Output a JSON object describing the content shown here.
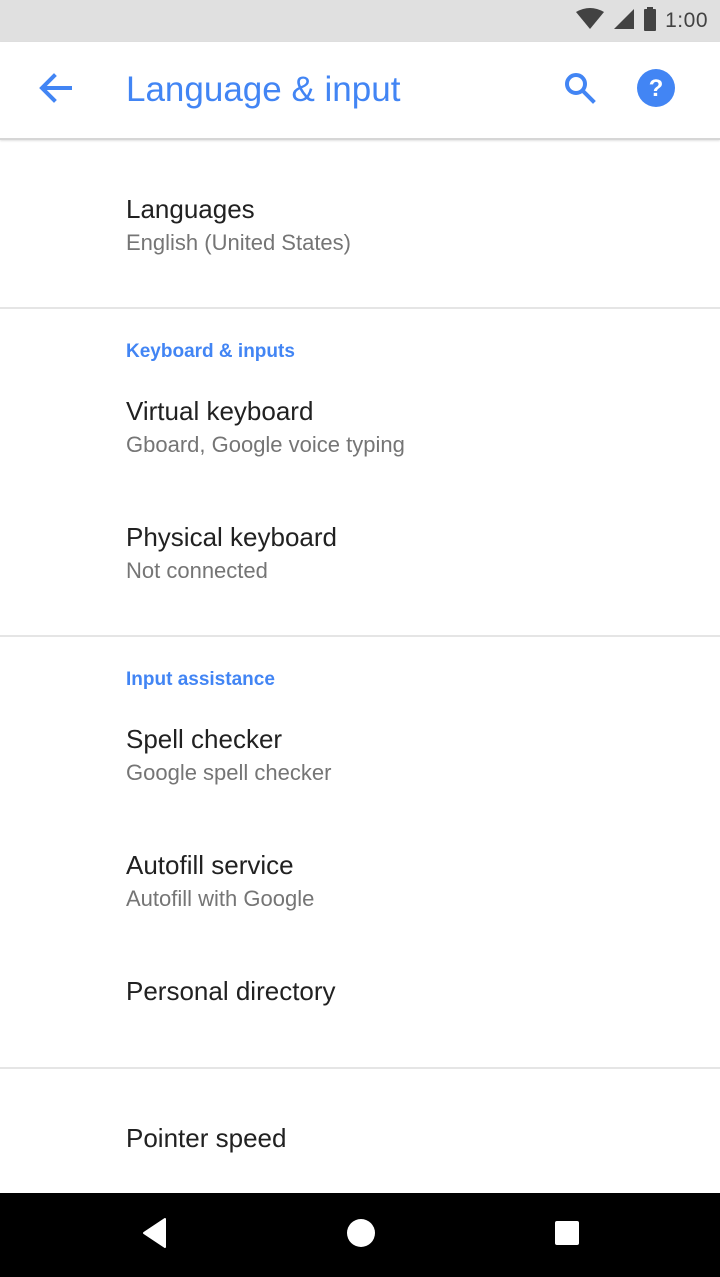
{
  "status_bar": {
    "time": "1:00",
    "icons": [
      "wifi-icon",
      "cell-signal-icon",
      "battery-icon"
    ]
  },
  "app_bar": {
    "title": "Language & input",
    "back_icon": "arrow-back-icon",
    "search_icon": "search-icon",
    "help_icon": "help-icon"
  },
  "colors": {
    "accent": "#4285f4",
    "title_text": "#212121",
    "summary_text": "#757575",
    "status_bar_bg": "#e0e0e0",
    "nav_bar_bg": "#000000"
  },
  "sections": [
    {
      "category": null,
      "items": [
        {
          "title": "Languages",
          "summary": "English (United States)"
        }
      ]
    },
    {
      "category": "Keyboard & inputs",
      "items": [
        {
          "title": "Virtual keyboard",
          "summary": "Gboard, Google voice typing"
        },
        {
          "title": "Physical keyboard",
          "summary": "Not connected"
        }
      ]
    },
    {
      "category": "Input assistance",
      "items": [
        {
          "title": "Spell checker",
          "summary": "Google spell checker"
        },
        {
          "title": "Autofill service",
          "summary": "Autofill with Google"
        },
        {
          "title": "Personal directory",
          "summary": null
        }
      ]
    },
    {
      "category": null,
      "items": [
        {
          "title": "Pointer speed",
          "summary": null
        }
      ]
    }
  ],
  "nav_bar": {
    "buttons": [
      "back-triangle-icon",
      "home-circle-icon",
      "recents-square-icon"
    ]
  }
}
